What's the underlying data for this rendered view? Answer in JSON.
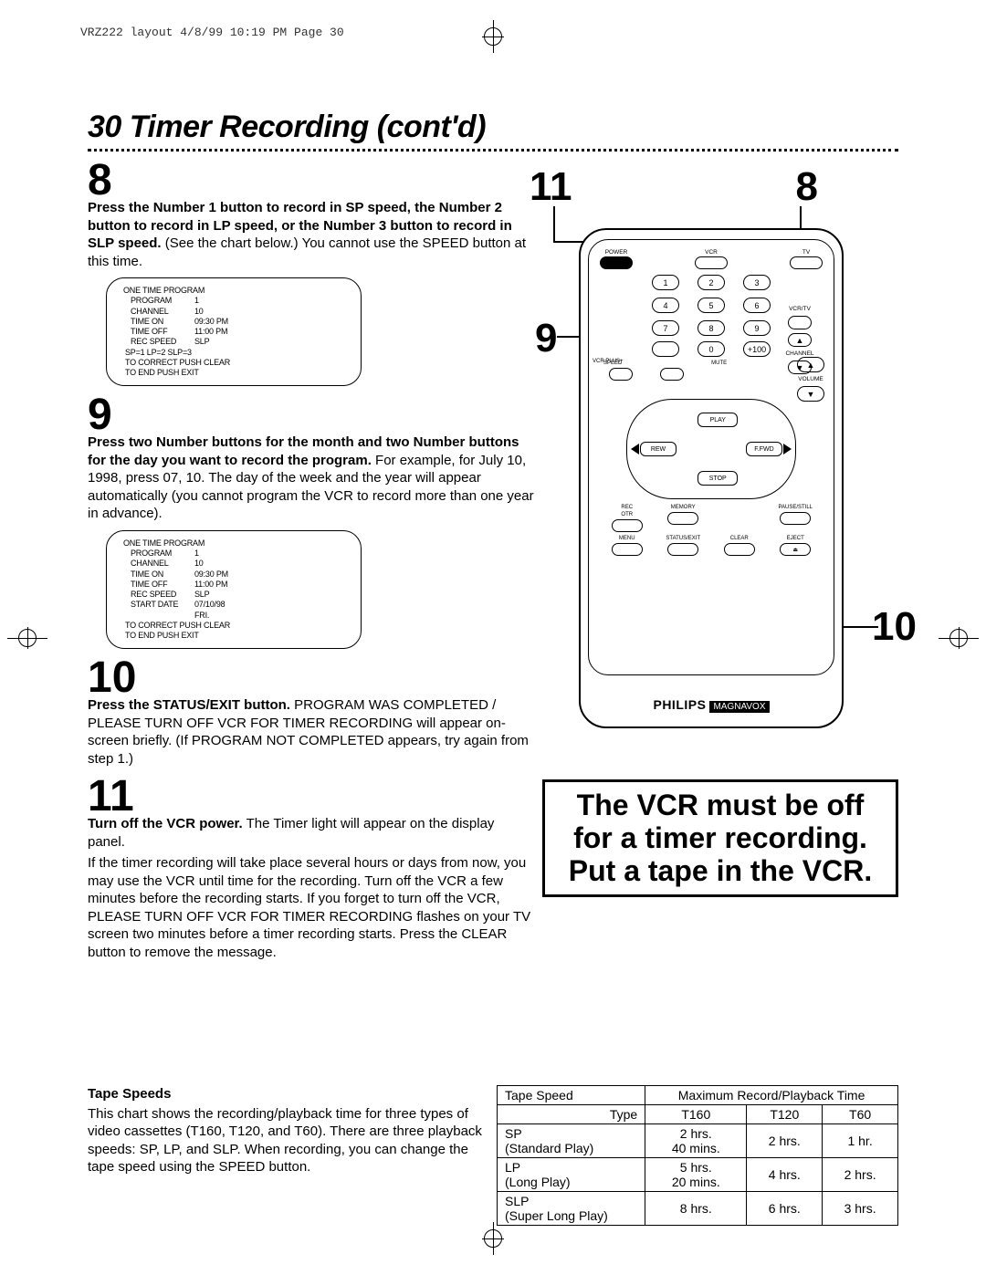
{
  "header_info": "VRZ222 layout  4/8/99 10:19 PM  Page 30",
  "title": "30  Timer Recording (cont'd)",
  "right_callouts": {
    "c11": "11",
    "c8": "8",
    "c9": "9",
    "c10": "10"
  },
  "steps": {
    "s8": {
      "num": "8",
      "bold": "Press the Number 1 button to record in SP speed, the Number 2 button to record in LP speed, or the Number 3 button to record in SLP speed.",
      "rest": " (See the chart below.) You cannot use the SPEED button at this time."
    },
    "s9": {
      "num": "9",
      "bold": "Press two Number buttons for the month and two Number buttons for the day you want to record the program.",
      "rest": " For example, for July 10, 1998, press 07, 10. The day of the week and the year will appear automatically (you cannot program the VCR to record more than one year in advance)."
    },
    "s10": {
      "num": "10",
      "bold": "Press the STATUS/EXIT button.",
      "rest": " PROGRAM WAS COMPLETED / PLEASE TURN OFF VCR FOR TIMER RECORDING will appear on-screen briefly. (If PROGRAM NOT COMPLETED appears, try again from step 1.)"
    },
    "s11": {
      "num": "11",
      "bold": "Turn off the VCR power.",
      "rest": " The Timer light will appear on the display panel.",
      "para2": "If the timer recording will take place several hours or days from now, you may use the VCR until time for the recording. Turn off the VCR a few minutes before the recording starts. If you forget to turn off the VCR, PLEASE TURN OFF VCR FOR TIMER RECORDING flashes on your TV screen two minutes before a timer recording starts. Press the CLEAR button to remove the message."
    }
  },
  "osd1": {
    "title": "ONE TIME PROGRAM",
    "rows": [
      [
        "PROGRAM",
        "1"
      ],
      [
        "CHANNEL",
        "10"
      ],
      [
        "TIME ON",
        "09:30 PM"
      ],
      [
        "TIME OFF",
        "11:00 PM"
      ],
      [
        "REC SPEED",
        "SLP"
      ]
    ],
    "speedline": "SP=1   LP=2   SLP=3",
    "note1": "TO CORRECT PUSH CLEAR",
    "note2": "TO END PUSH EXIT"
  },
  "osd2": {
    "title": "ONE TIME PROGRAM",
    "rows": [
      [
        "PROGRAM",
        "1"
      ],
      [
        "CHANNEL",
        "10"
      ],
      [
        "TIME ON",
        "09:30 PM"
      ],
      [
        "TIME OFF",
        "11:00 PM"
      ],
      [
        "REC SPEED",
        "SLP"
      ],
      [
        "START DATE",
        "07/10/98"
      ],
      [
        "",
        "FRI."
      ]
    ],
    "note1": "TO CORRECT PUSH CLEAR",
    "note2": "TO END PUSH EXIT"
  },
  "callout_text": "The VCR must be off for a timer recording. Put a tape in the VCR.",
  "remote": {
    "power": "POWER",
    "vcr": "VCR",
    "tv": "TV",
    "vcrtv": "VCR/TV",
    "channel": "CHANNEL",
    "vcrplus": "VCR PLUS+",
    "speed": "SPEED",
    "mute": "MUTE",
    "volume": "VOLUME",
    "play": "PLAY",
    "rew": "REW",
    "ffwd": "F.FWD",
    "stop": "STOP",
    "rec": "REC",
    "otr": "OTR",
    "memory": "MEMORY",
    "pause": "PAUSE/STILL",
    "menu": "MENU",
    "status": "STATUS/EXIT",
    "clear": "CLEAR",
    "eject": "EJECT",
    "nums": [
      "1",
      "2",
      "3",
      "4",
      "5",
      "6",
      "7",
      "8",
      "9",
      "0",
      "+100"
    ],
    "brand": "PHILIPS",
    "brand2": "MAGNAVOX"
  },
  "tape": {
    "title": "Tape Speeds",
    "desc": "This chart shows the recording/playback time for three types of video cassettes (T160, T120, and T60). There are three playback speeds: SP, LP, and SLP. When recording, you can change the tape speed using the SPEED button.",
    "h_speed": "Tape Speed",
    "h_max": "Maximum Record/Playback Time",
    "h_type": "Type",
    "h_t160": "T160",
    "h_t120": "T120",
    "h_t60": "T60",
    "sp_name": "SP",
    "sp_sub": "(Standard Play)",
    "sp_t160a": "2 hrs.",
    "sp_t160b": "40 mins.",
    "sp_t120": "2 hrs.",
    "sp_t60": "1 hr.",
    "lp_name": "LP",
    "lp_sub": "(Long Play)",
    "lp_t160a": "5 hrs.",
    "lp_t160b": "20 mins.",
    "lp_t120": "4 hrs.",
    "lp_t60": "2 hrs.",
    "slp_name": "SLP",
    "slp_sub": "(Super Long Play)",
    "slp_t160": "8 hrs.",
    "slp_t120": "6 hrs.",
    "slp_t60": "3 hrs."
  }
}
